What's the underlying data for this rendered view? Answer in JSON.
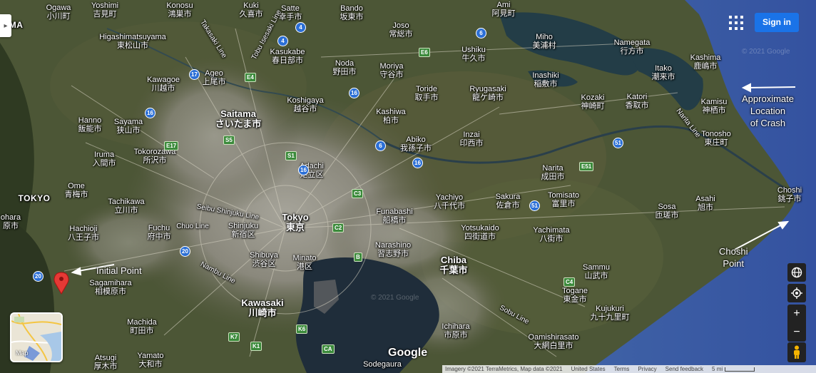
{
  "map": {
    "type": "satellite",
    "colors": {
      "land": "#4a5534",
      "urban": "#8c8a80",
      "water": "#243443",
      "ocean": "#3a5a9a",
      "lake": "#23404a"
    }
  },
  "places": [
    {
      "id": "ogawa",
      "en": "Ogawa",
      "jp": "小川町"
    },
    {
      "id": "yoshimi",
      "en": "Yoshimi",
      "jp": "吉見町"
    },
    {
      "id": "konosu",
      "en": "Konosu",
      "jp": "鴻巣市"
    },
    {
      "id": "kuki",
      "en": "Kuki",
      "jp": "久喜市"
    },
    {
      "id": "satte",
      "en": "Satte",
      "jp": "幸手市"
    },
    {
      "id": "bando",
      "en": "Bando",
      "jp": "坂東市"
    },
    {
      "id": "ami",
      "en": "Ami",
      "jp": "阿見町"
    },
    {
      "id": "higashimatsuyama",
      "en": "Higashimatsuyama",
      "jp": "東松山市"
    },
    {
      "id": "kasukabe",
      "en": "Kasukabe",
      "jp": "春日部市"
    },
    {
      "id": "joso",
      "en": "Joso",
      "jp": "常総市"
    },
    {
      "id": "miho",
      "en": "Miho",
      "jp": "美浦村"
    },
    {
      "id": "namegata",
      "en": "Namegata",
      "jp": "行方市"
    },
    {
      "id": "ushiku",
      "en": "Ushiku",
      "jp": "牛久市"
    },
    {
      "id": "kawagoe",
      "en": "Kawagoe",
      "jp": "川越市"
    },
    {
      "id": "ageo",
      "en": "Ageo",
      "jp": "上尾市"
    },
    {
      "id": "noda",
      "en": "Noda",
      "jp": "野田市"
    },
    {
      "id": "moriya",
      "en": "Moriya",
      "jp": "守谷市"
    },
    {
      "id": "kashima",
      "en": "Kashima",
      "jp": "鹿嶋市"
    },
    {
      "id": "itako",
      "en": "Itako",
      "jp": "潮来市"
    },
    {
      "id": "inashiki",
      "en": "Inashiki",
      "jp": "稲敷市"
    },
    {
      "id": "ryugasaki",
      "en": "Ryugasaki",
      "jp": "龍ケ崎市"
    },
    {
      "id": "toride",
      "en": "Toride",
      "jp": "取手市"
    },
    {
      "id": "koshigaya",
      "en": "Koshigaya",
      "jp": "越谷市"
    },
    {
      "id": "kozaki",
      "en": "Kozaki",
      "jp": "神崎町"
    },
    {
      "id": "katori",
      "en": "Katori",
      "jp": "香取市"
    },
    {
      "id": "kamisu",
      "en": "Kamisu",
      "jp": "神栖市"
    },
    {
      "id": "saitama",
      "en": "Saitama",
      "jp": "さいたま市",
      "big": true
    },
    {
      "id": "hanno",
      "en": "Hanno",
      "jp": "飯能市"
    },
    {
      "id": "sayama",
      "en": "Sayama",
      "jp": "狭山市"
    },
    {
      "id": "kashiwa",
      "en": "Kashiwa",
      "jp": "柏市"
    },
    {
      "id": "abiko",
      "en": "Abiko",
      "jp": "我孫子市"
    },
    {
      "id": "inzai",
      "en": "Inzai",
      "jp": "印西市"
    },
    {
      "id": "tonosho",
      "en": "Tonosho",
      "jp": "東庄町"
    },
    {
      "id": "tokorozawa",
      "en": "Tokorozawa",
      "jp": "所沢市"
    },
    {
      "id": "iruma",
      "en": "Iruma",
      "jp": "入間市"
    },
    {
      "id": "adachi",
      "en": "Adachi",
      "jp": "足立区"
    },
    {
      "id": "narita",
      "en": "Narita",
      "jp": "成田市"
    },
    {
      "id": "ome",
      "en": "Ome",
      "jp": "青梅市"
    },
    {
      "id": "yachiyo",
      "en": "Yachiyo",
      "jp": "八千代市"
    },
    {
      "id": "sakura",
      "en": "Sakura",
      "jp": "佐倉市"
    },
    {
      "id": "tomisato",
      "en": "Tomisato",
      "jp": "富里市"
    },
    {
      "id": "asahi",
      "en": "Asahi",
      "jp": "旭市"
    },
    {
      "id": "choshi",
      "en": "Choshi",
      "jp": "銚子市"
    },
    {
      "id": "tachikawa",
      "en": "Tachikawa",
      "jp": "立川市"
    },
    {
      "id": "funabashi",
      "en": "Funabashi",
      "jp": "船橋市"
    },
    {
      "id": "sosa",
      "en": "Sosa",
      "jp": "匝瑳市"
    },
    {
      "id": "tokyo",
      "en": "Tokyo",
      "jp": "東京",
      "big": true
    },
    {
      "id": "hachioji",
      "en": "Hachioji",
      "jp": "八王子市"
    },
    {
      "id": "fuchu",
      "en": "Fuchu",
      "jp": "府中市"
    },
    {
      "id": "shinjuku",
      "en": "Shinjuku",
      "jp": "新宿区"
    },
    {
      "id": "yotsukaido",
      "en": "Yotsukaido",
      "jp": "四街道市"
    },
    {
      "id": "yachimata",
      "en": "Yachimata",
      "jp": "八街市"
    },
    {
      "id": "narashino",
      "en": "Narashino",
      "jp": "習志野市"
    },
    {
      "id": "shibuya",
      "en": "Shibuya",
      "jp": "渋谷区"
    },
    {
      "id": "minato",
      "en": "Minato",
      "jp": "港区"
    },
    {
      "id": "chiba",
      "en": "Chiba",
      "jp": "千葉市",
      "big": true
    },
    {
      "id": "sammu",
      "en": "Sammu",
      "jp": "山武市"
    },
    {
      "id": "sagamihara",
      "en": "Sagamihara",
      "jp": "相模原市"
    },
    {
      "id": "kawasaki",
      "en": "Kawasaki",
      "jp": "川崎市",
      "big": true
    },
    {
      "id": "togane",
      "en": "Togane",
      "jp": "東金市"
    },
    {
      "id": "kujukuri",
      "en": "Kujukuri",
      "jp": "九十九里町"
    },
    {
      "id": "machida",
      "en": "Machida",
      "jp": "町田市"
    },
    {
      "id": "ichihara",
      "en": "Ichihara",
      "jp": "市原市"
    },
    {
      "id": "oamishirasato",
      "en": "Oamishirasato",
      "jp": "大網白里市"
    },
    {
      "id": "atsugi",
      "en": "Atsugi",
      "jp": "厚木市"
    },
    {
      "id": "yamato",
      "en": "Yamato",
      "jp": "大和市"
    },
    {
      "id": "sodegaura",
      "en": "Sodegaura",
      "jp": ""
    }
  ],
  "regions": {
    "tokyo_pref": "TOKYO",
    "saitama_edge": "AMA"
  },
  "partial_labels": {
    "ohara": "ohara",
    "ohara_jp": "原市"
  },
  "rail_lines": [
    "Takasaki Line",
    "Tobu Isesaki Line",
    "Seibu Shinjuku Line",
    "Chuo Line",
    "Nambu Line",
    "Narita Line",
    "Sobu Line"
  ],
  "route_shields": [
    "17",
    "16",
    "16",
    "4",
    "4",
    "6",
    "16",
    "6",
    "16",
    "20",
    "20",
    "51",
    "51",
    "E17",
    "S5",
    "S1",
    "C3",
    "C2",
    "E4",
    "E6",
    "E51",
    "B",
    "C4",
    "K7",
    "K6",
    "K1",
    "CA"
  ],
  "annotations": {
    "crash": "Approximate Location of Crash",
    "crash_l1": "Approximate",
    "crash_l2": "Location",
    "crash_l3": "of Crash",
    "choshi_point_l1": "Choshi",
    "choshi_point_l2": "Point",
    "initial_point": "Initial Point"
  },
  "controls": {
    "sign_in": "Sign in",
    "expand_icon": "chevron-right-icon",
    "apps_icon": "apps-grid-icon",
    "zoom_in": "+",
    "zoom_out": "−",
    "layer_toggle_label": "Map"
  },
  "watermarks": {
    "copyright_a": "© 2021 Google",
    "copyright_b": "© 2021 Google"
  },
  "logo": "Google",
  "footer": {
    "attribution": "Imagery ©2021 TerraMetrics, Map data ©2021",
    "country": "United States",
    "terms": "Terms",
    "privacy": "Privacy",
    "feedback": "Send feedback",
    "scale": "5 mi"
  }
}
